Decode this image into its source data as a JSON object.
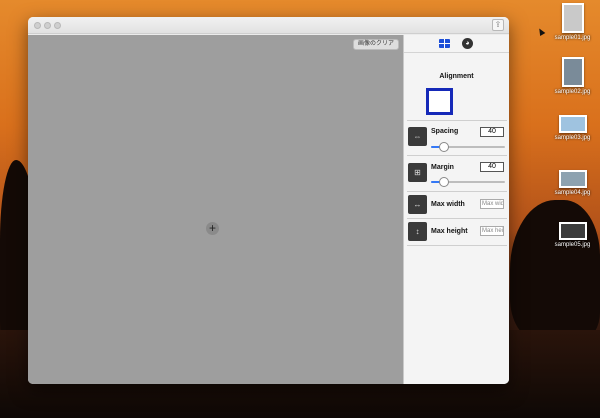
{
  "window": {
    "canvas": {
      "clear_button": "画像のクリア",
      "add_icon": "+"
    },
    "inspector": {
      "tabs": [
        {
          "name": "layout",
          "icon": "grid-icon",
          "active": true
        },
        {
          "name": "style",
          "icon": "palette-icon",
          "active": false
        }
      ],
      "alignment_label": "Alignment",
      "spacing": {
        "label": "Spacing",
        "value": "40",
        "slider_fraction": 0.13
      },
      "margin": {
        "label": "Margin",
        "value": "40",
        "slider_fraction": 0.13
      },
      "max_width": {
        "label": "Max width",
        "placeholder": "Max width"
      },
      "max_height": {
        "label": "Max height",
        "placeholder": "Max height"
      }
    }
  },
  "desktop": {
    "files": [
      {
        "label": "sample01.jpg"
      },
      {
        "label": "sample02.jpg"
      },
      {
        "label": "sample03.jpg"
      },
      {
        "label": "sample04.jpg"
      },
      {
        "label": "sample05.jpg"
      }
    ]
  },
  "colors": {
    "accent": "#1d4fd8",
    "alignment_border": "#1529b8",
    "canvas": "#9e9e9e"
  }
}
